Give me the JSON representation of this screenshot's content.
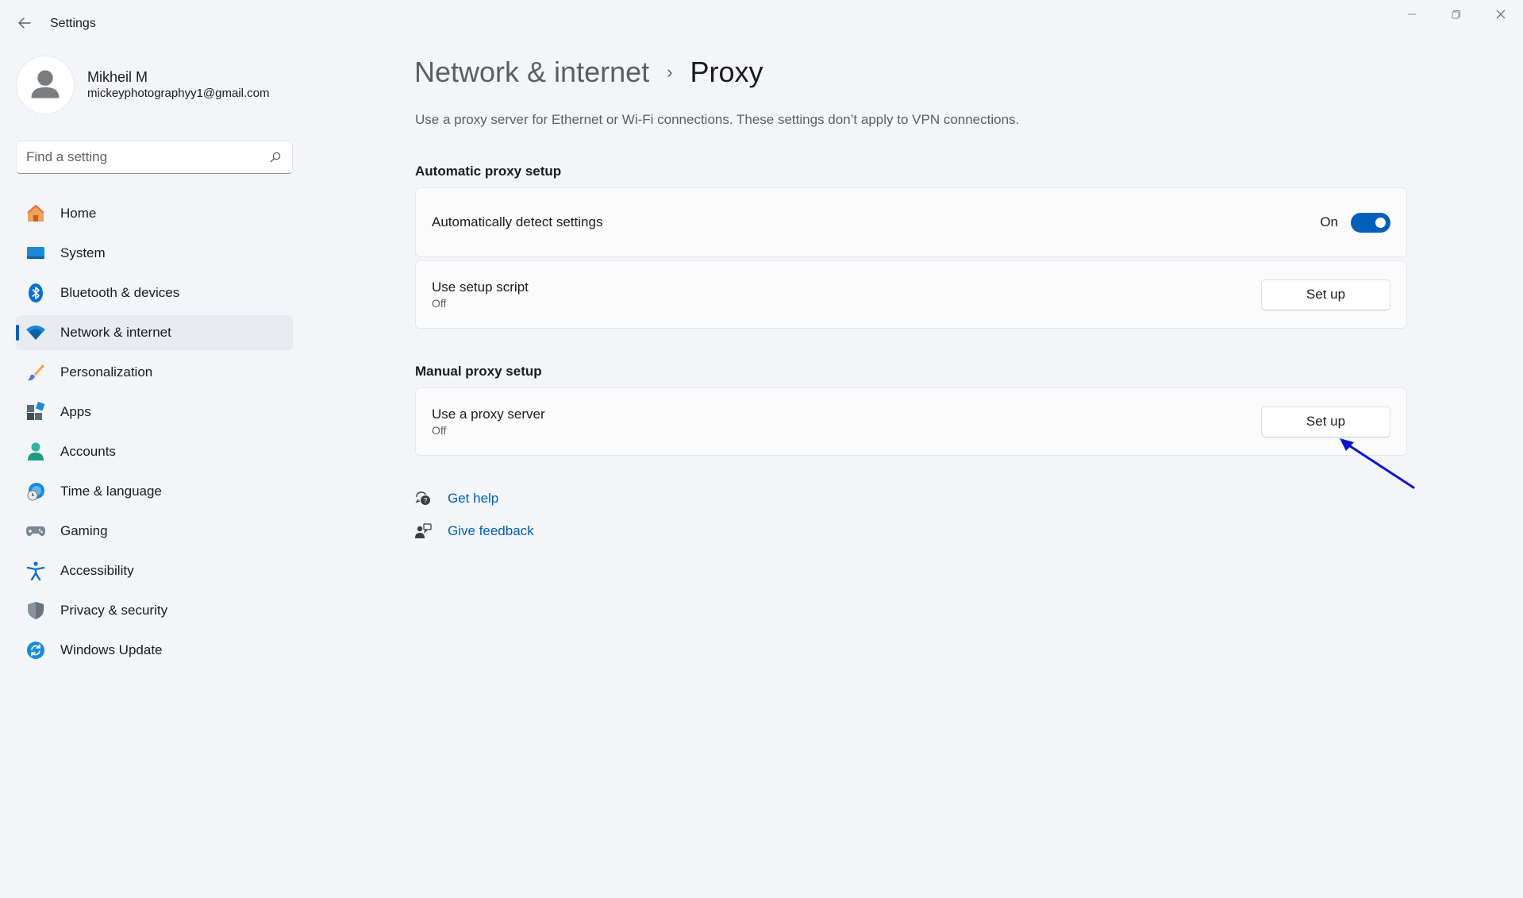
{
  "titlebar": {
    "app_title": "Settings",
    "back_icon": "back-arrow-icon",
    "controls": [
      "minimize-icon",
      "restore-icon",
      "close-icon"
    ]
  },
  "profile": {
    "name": "Mikheil M",
    "email": "mickeyphotographyy1@gmail.com"
  },
  "search": {
    "placeholder": "Find a setting"
  },
  "sidebar": {
    "items": [
      {
        "label": "Home",
        "icon": "home-icon",
        "active": false
      },
      {
        "label": "System",
        "icon": "system-icon",
        "active": false
      },
      {
        "label": "Bluetooth & devices",
        "icon": "bluetooth-icon",
        "active": false
      },
      {
        "label": "Network & internet",
        "icon": "wifi-icon",
        "active": true
      },
      {
        "label": "Personalization",
        "icon": "brush-icon",
        "active": false
      },
      {
        "label": "Apps",
        "icon": "apps-icon",
        "active": false
      },
      {
        "label": "Accounts",
        "icon": "accounts-icon",
        "active": false
      },
      {
        "label": "Time & language",
        "icon": "clock-globe-icon",
        "active": false
      },
      {
        "label": "Gaming",
        "icon": "gamepad-icon",
        "active": false
      },
      {
        "label": "Accessibility",
        "icon": "accessibility-icon",
        "active": false
      },
      {
        "label": "Privacy & security",
        "icon": "shield-icon",
        "active": false
      },
      {
        "label": "Windows Update",
        "icon": "update-icon",
        "active": false
      }
    ]
  },
  "main": {
    "breadcrumb_parent": "Network & internet",
    "breadcrumb_sep": "›",
    "breadcrumb_current": "Proxy",
    "description": "Use a proxy server for Ethernet or Wi-Fi connections. These settings don’t apply to VPN connections.",
    "automatic": {
      "title": "Automatic proxy setup",
      "detect_label": "Automatically detect settings",
      "detect_state": "On",
      "script_label": "Use setup script",
      "script_state": "Off",
      "script_button": "Set up"
    },
    "manual": {
      "title": "Manual proxy setup",
      "proxy_label": "Use a proxy server",
      "proxy_state": "Off",
      "proxy_button": "Set up"
    },
    "help": {
      "get_help": "Get help",
      "give_feedback": "Give feedback"
    }
  },
  "colors": {
    "accent": "#005fb8",
    "background": "#f3f5f9",
    "card": "#fbfbfb",
    "annotation_arrow": "#0a16c8"
  }
}
